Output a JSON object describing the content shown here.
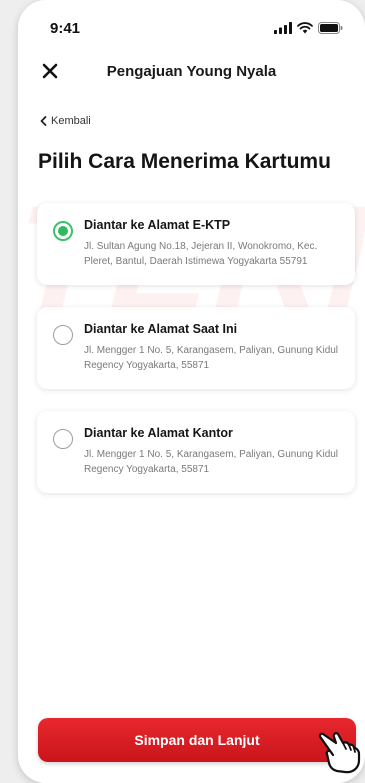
{
  "status_bar": {
    "time": "9:41"
  },
  "header": {
    "title": "Pengajuan Young Nyala"
  },
  "back": {
    "label": "Kembali"
  },
  "page": {
    "title": "Pilih Cara Menerima Kartumu"
  },
  "watermark": {
    "text": "TERN"
  },
  "options": [
    {
      "title": "Diantar ke Alamat E-KTP",
      "address": "Jl. Sultan Agung No.18, Jejeran II, Wonokromo, Kec. Pleret, Bantul, Daerah Istimewa Yogyakarta 55791",
      "selected": true
    },
    {
      "title": "Diantar ke Alamat Saat Ini",
      "address": "Jl. Mengger 1 No. 5, Karangasem, Paliyan, Gunung Kidul Regency Yogyakarta, 55871",
      "selected": false
    },
    {
      "title": "Diantar ke Alamat Kantor",
      "address": "Jl. Mengger 1 No. 5, Karangasem, Paliyan, Gunung Kidul Regency Yogyakarta, 55871",
      "selected": false
    }
  ],
  "footer": {
    "submit_label": "Simpan dan Lanjut"
  },
  "colors": {
    "primary": "#d71920",
    "selected_radio": "#2fb960",
    "text_dark": "#161616",
    "text_muted": "#7a7a7a"
  },
  "icons": {
    "close": "close-icon",
    "back": "chevron-left-icon",
    "signal": "signal-icon",
    "wifi": "wifi-icon",
    "battery": "battery-icon",
    "hand": "hand-pointer-icon"
  }
}
